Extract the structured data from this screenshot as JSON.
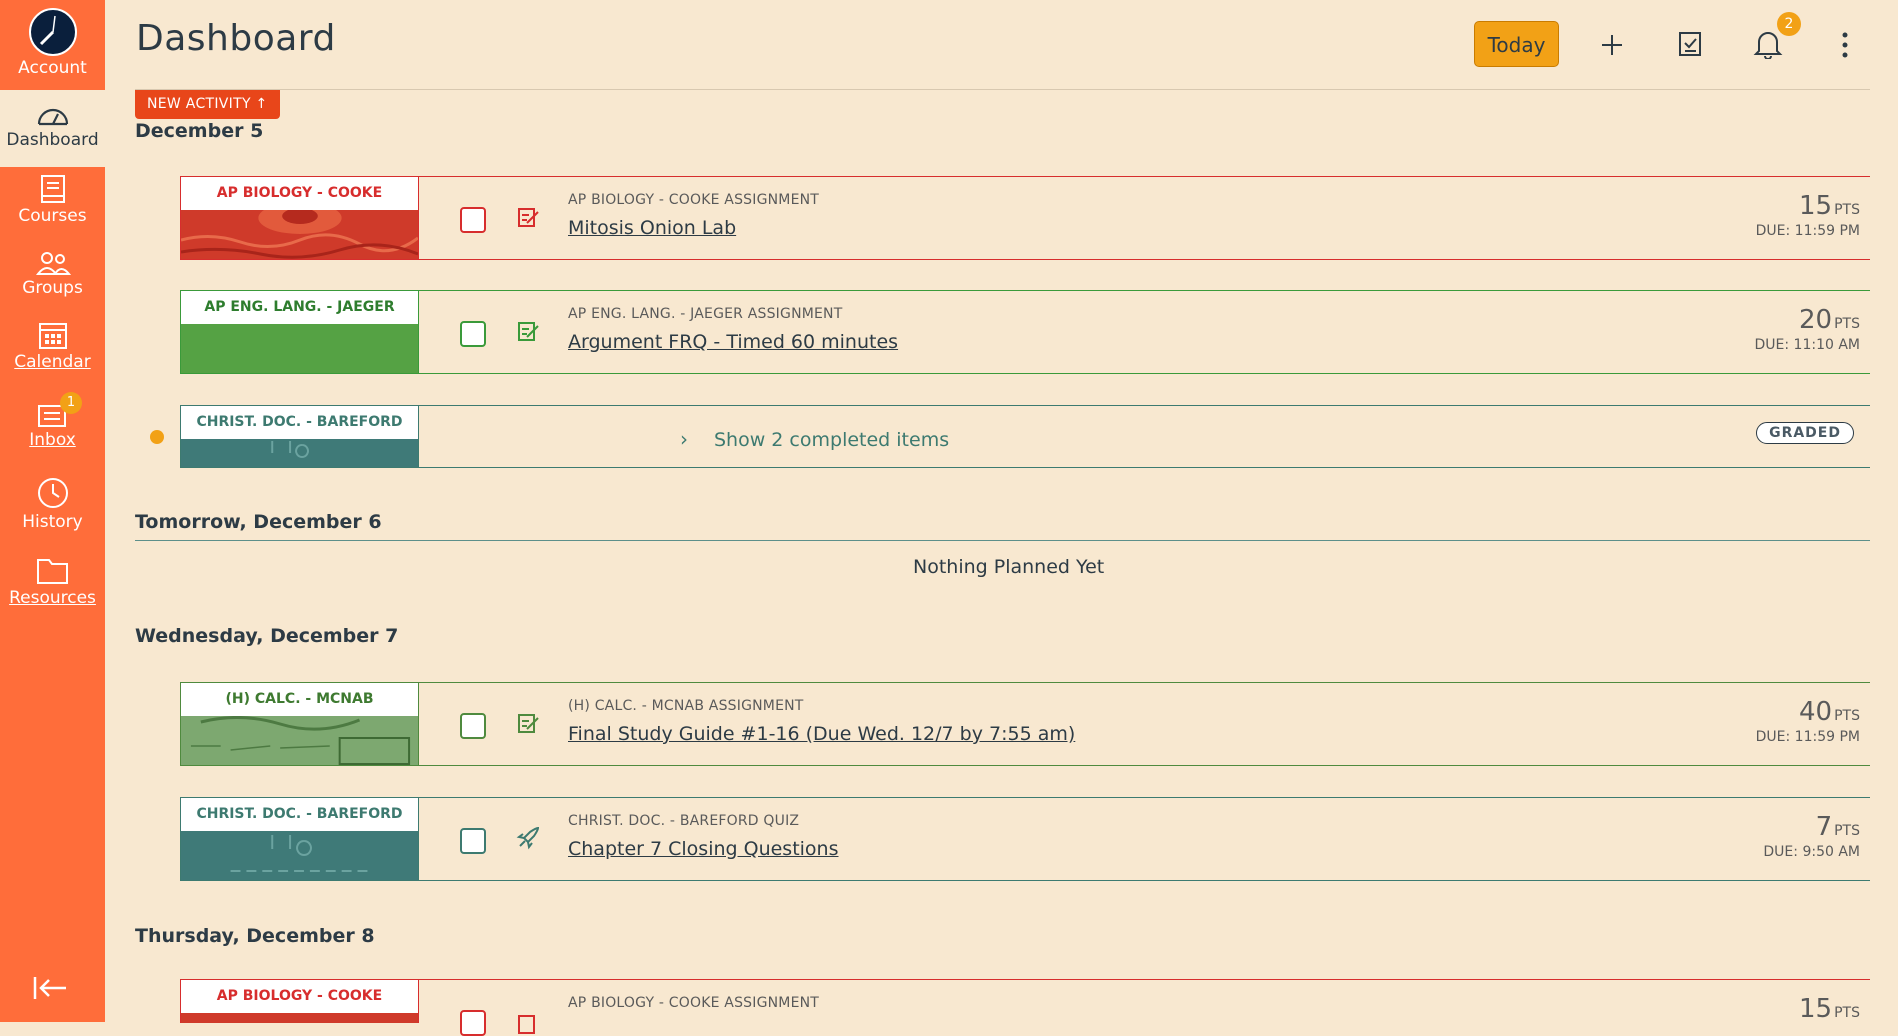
{
  "nav": {
    "account": "Account",
    "dashboard": "Dashboard",
    "courses": "Courses",
    "groups": "Groups",
    "calendar": "Calendar",
    "inbox": "Inbox",
    "inbox_badge": "1",
    "history": "History",
    "resources": "Resources"
  },
  "header": {
    "title": "Dashboard",
    "today_label": "Today",
    "notifications_badge": "2",
    "new_activity": "NEW ACTIVITY ↑"
  },
  "days": [
    {
      "heading": "December 5",
      "items": [
        {
          "course": "AP BIOLOGY - COOKE",
          "meta": "AP BIOLOGY - COOKE ASSIGNMENT",
          "title": "Mitosis Onion Lab",
          "pts": "15",
          "pts_unit": "PTS",
          "due": "DUE: 11:59 PM",
          "color": "#d72d2d",
          "icon": "assignment-icon"
        },
        {
          "course": "AP ENG. LANG. - JAEGER",
          "meta": "AP ENG. LANG. - JAEGER ASSIGNMENT",
          "title": "Argument FRQ - Timed 60 minutes",
          "pts": "20",
          "pts_unit": "PTS",
          "due": "DUE: 11:10 AM",
          "color": "#3a9a3a",
          "icon": "assignment-icon"
        }
      ],
      "completed": {
        "course": "CHRIST. DOC. - BAREFORD",
        "label": "Show 2 completed items",
        "badge": "GRADED",
        "color": "#3d7a70"
      }
    },
    {
      "heading": "Tomorrow, December 6",
      "empty": "Nothing Planned Yet"
    },
    {
      "heading": "Wednesday, December 7",
      "items": [
        {
          "course": "(H) CALC. - MCNAB",
          "meta": "(H) CALC. - MCNAB ASSIGNMENT",
          "title": "Final Study Guide #1-16 (Due Wed. 12/7 by 7:55 am)",
          "pts": "40",
          "pts_unit": "PTS",
          "due": "DUE: 11:59 PM",
          "color": "#4f8a3e",
          "icon": "assignment-icon"
        },
        {
          "course": "CHRIST. DOC. - BAREFORD",
          "meta": "CHRIST. DOC. - BAREFORD QUIZ",
          "title": "Chapter 7 Closing Questions",
          "pts": "7",
          "pts_unit": "PTS",
          "due": "DUE: 9:50 AM",
          "color": "#3d7a70",
          "icon": "quiz-rocket-icon"
        }
      ]
    },
    {
      "heading": "Thursday, December 8",
      "items": [
        {
          "course": "AP BIOLOGY - COOKE",
          "meta": "AP BIOLOGY - COOKE ASSIGNMENT",
          "pts": "15",
          "pts_unit": "PTS",
          "color": "#d72d2d",
          "icon": "assignment-icon"
        }
      ]
    }
  ]
}
